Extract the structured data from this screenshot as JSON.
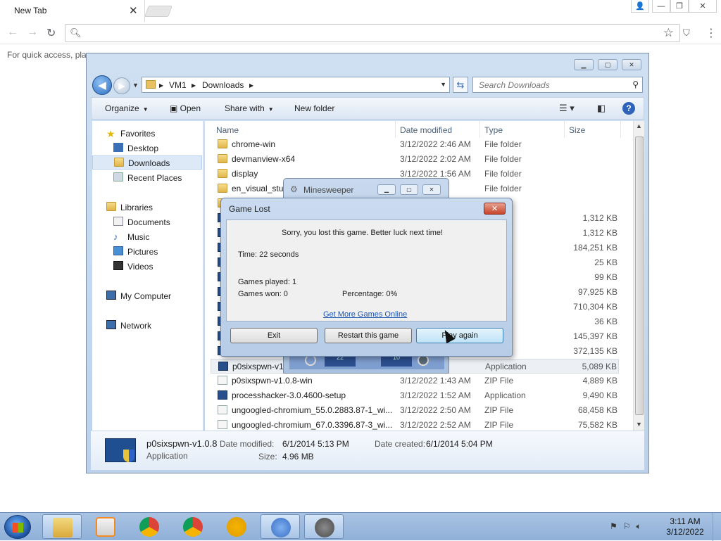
{
  "browser": {
    "tab_title": "New Tab",
    "tab_close": "✕",
    "bookmark_hint": "For quick access, plac"
  },
  "explorer": {
    "breadcrumb": [
      "VM1",
      "Downloads"
    ],
    "search_placeholder": "Search Downloads",
    "commands": {
      "organize": "Organize",
      "open": "Open",
      "share": "Share with",
      "new_folder": "New folder"
    },
    "nav": {
      "favorites": "Favorites",
      "desktop": "Desktop",
      "downloads": "Downloads",
      "recent": "Recent Places",
      "libraries": "Libraries",
      "documents": "Documents",
      "music": "Music",
      "pictures": "Pictures",
      "videos": "Videos",
      "computer": "My Computer",
      "network": "Network"
    },
    "columns": {
      "name": "Name",
      "date": "Date modified",
      "type": "Type",
      "size": "Size"
    },
    "rows": [
      {
        "name": "chrome-win",
        "date": "3/12/2022 2:46 AM",
        "type": "File folder",
        "size": ""
      },
      {
        "name": "devmanview-x64",
        "date": "3/12/2022 2:02 AM",
        "type": "File folder",
        "size": ""
      },
      {
        "name": "display",
        "date": "3/12/2022 1:56 AM",
        "type": "File folder",
        "size": ""
      },
      {
        "name": "en_visual_stud",
        "date": "2 AM",
        "type": "File folder",
        "size": ""
      },
      {
        "name": "",
        "date": "",
        "type": "der",
        "size": ""
      },
      {
        "name": "",
        "date": "",
        "type": "ation",
        "size": "1,312 KB"
      },
      {
        "name": "",
        "date": "",
        "type": "ation",
        "size": "1,312 KB"
      },
      {
        "name": "",
        "date": "",
        "type": "",
        "size": "184,251 KB"
      },
      {
        "name": "",
        "date": "",
        "type": "",
        "size": "25 KB"
      },
      {
        "name": "",
        "date": "",
        "type": "",
        "size": "99 KB"
      },
      {
        "name": "",
        "date": "",
        "type": "ation",
        "size": "97,925 KB"
      },
      {
        "name": "",
        "date": "",
        "type": "ive",
        "size": "710,304 KB"
      },
      {
        "name": "",
        "date": "",
        "type": "",
        "size": "36 KB"
      },
      {
        "name": "",
        "date": "",
        "type": "ation",
        "size": "145,397 KB"
      },
      {
        "name": "",
        "date": "",
        "type": "",
        "size": "372,135 KB"
      },
      {
        "name": "p0sixspwn-v1.",
        "date": "PM",
        "type": "Application",
        "size": "5,089 KB"
      },
      {
        "name": "p0sixspwn-v1.0.8-win",
        "date": "3/12/2022 1:43 AM",
        "type": "ZIP File",
        "size": "4,889 KB"
      },
      {
        "name": "processhacker-3.0.4600-setup",
        "date": "3/12/2022 1:52 AM",
        "type": "Application",
        "size": "9,490 KB"
      },
      {
        "name": "ungoogled-chromium_55.0.2883.87-1_wi...",
        "date": "3/12/2022 2:50 AM",
        "type": "ZIP File",
        "size": "68,458 KB"
      },
      {
        "name": "ungoogled-chromium_67.0.3396.87-3_wi...",
        "date": "3/12/2022 2:52 AM",
        "type": "ZIP File",
        "size": "75,582 KB"
      }
    ],
    "details": {
      "name": "p0sixspwn-v1.0.8",
      "type": "Application",
      "modified_label": "Date modified:",
      "modified": "6/1/2014 5:13 PM",
      "created_label": "Date created:",
      "created": "6/1/2014 5:04 PM",
      "size_label": "Size:",
      "size": "4.96 MB"
    }
  },
  "minesweeper": {
    "title": "Minesweeper",
    "time": "22",
    "mines": "10"
  },
  "dialog": {
    "title": "Game Lost",
    "message": "Sorry, you lost this game. Better luck next time!",
    "time": "Time: 22 seconds",
    "played": "Games played: 1",
    "won": "Games won: 0",
    "percentage": "Percentage: 0%",
    "link": "Get More Games Online",
    "btn_exit": "Exit",
    "btn_restart": "Restart this game",
    "btn_play": "Play again"
  },
  "taskbar": {
    "time": "3:11 AM",
    "date": "3/12/2022"
  }
}
